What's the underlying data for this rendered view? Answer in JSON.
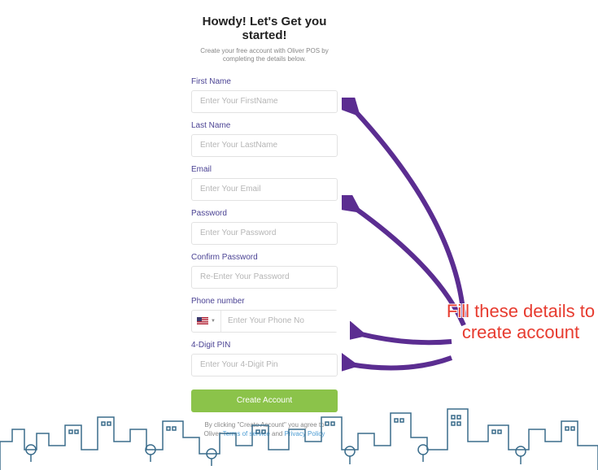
{
  "header": {
    "title": "Howdy! Let's Get you started!",
    "subtitle": "Create your free account with Oliver POS by completing the details below."
  },
  "fields": {
    "first_name": {
      "label": "First Name",
      "placeholder": "Enter Your FirstName"
    },
    "last_name": {
      "label": "Last Name",
      "placeholder": "Enter Your LastName"
    },
    "email": {
      "label": "Email",
      "placeholder": "Enter Your Email"
    },
    "password": {
      "label": "Password",
      "placeholder": "Enter Your Password"
    },
    "confirm_password": {
      "label": "Confirm Password",
      "placeholder": "Re-Enter Your Password"
    },
    "phone": {
      "label": "Phone number",
      "placeholder": "Enter Your Phone No"
    },
    "pin": {
      "label": "4-Digit PIN",
      "placeholder": "Enter Your 4-Digit Pin"
    }
  },
  "submit_label": "Create Account",
  "disclaimer": {
    "prefix": "By clicking \"Create Account\" you agree to Oliver ",
    "tos": "Terms of service",
    "and": " and ",
    "privacy": "Privacy Policy"
  },
  "annotation": {
    "text": "Fill these details to create account"
  }
}
